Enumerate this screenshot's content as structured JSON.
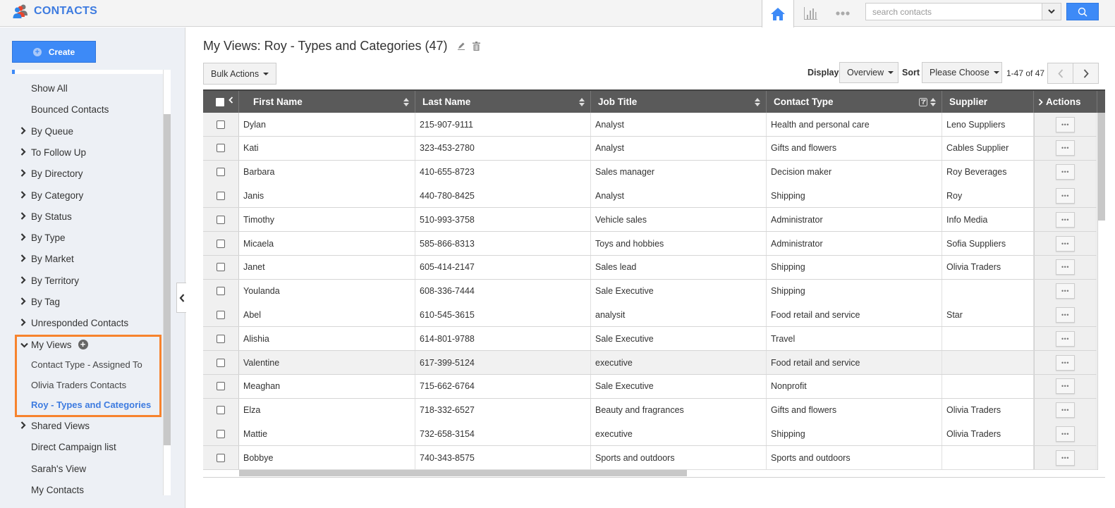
{
  "app": {
    "title": "CONTACTS",
    "icon": "contacts-people-icon",
    "brand_color": "#3d7be0"
  },
  "topbar": {
    "tabs": [
      {
        "name": "home",
        "icon": "home-icon",
        "active": true
      },
      {
        "name": "reports",
        "icon": "bar-chart-icon",
        "active": false
      },
      {
        "name": "more",
        "icon": "more-dots-icon",
        "active": false
      }
    ],
    "search": {
      "placeholder": "search contacts",
      "value": ""
    }
  },
  "sidebar": {
    "create_label": "Create",
    "items": [
      {
        "label": "Show All",
        "type": "plain"
      },
      {
        "label": "Bounced Contacts",
        "type": "plain"
      },
      {
        "label": "By Queue",
        "type": "group"
      },
      {
        "label": "To Follow Up",
        "type": "group"
      },
      {
        "label": "By Directory",
        "type": "group"
      },
      {
        "label": "By Category",
        "type": "group"
      },
      {
        "label": "By Status",
        "type": "group"
      },
      {
        "label": "By Type",
        "type": "group"
      },
      {
        "label": "By Market",
        "type": "group"
      },
      {
        "label": "By Territory",
        "type": "group"
      },
      {
        "label": "By Tag",
        "type": "group"
      },
      {
        "label": "Unresponded Contacts",
        "type": "group"
      },
      {
        "label": "My Views",
        "type": "expanded"
      },
      {
        "label": "Contact Type - Assigned To",
        "type": "child"
      },
      {
        "label": "Olivia Traders Contacts",
        "type": "child"
      },
      {
        "label": "Roy - Types and Categories",
        "type": "child",
        "active": true
      },
      {
        "label": "Shared Views",
        "type": "group"
      },
      {
        "label": "Direct Campaign list",
        "type": "plain"
      },
      {
        "label": "Sarah's View",
        "type": "plain"
      },
      {
        "label": "My Contacts",
        "type": "plain"
      }
    ]
  },
  "main": {
    "title": "My Views: Roy - Types and Categories (47)",
    "bulk_actions_label": "Bulk Actions",
    "display_label": "Display",
    "display_value": "Overview",
    "sort_label": "Sort",
    "sort_value": "Please Choose",
    "pager_text": "1-47 of 47",
    "columns": [
      "First Name",
      "Last Name",
      "Job Title",
      "Contact Type",
      "Supplier",
      "Actions"
    ],
    "actions_button_label": "•••",
    "rows": [
      {
        "first": "Dylan",
        "last": "215-907-9111",
        "job": "Analyst",
        "type": "Health and personal care",
        "supplier": "Leno Suppliers"
      },
      {
        "first": "Kati",
        "last": "323-453-2780",
        "job": "Analyst",
        "type": "Gifts and flowers",
        "supplier": "Cables Supplier"
      },
      {
        "first": "Barbara",
        "last": "410-655-8723",
        "job": "Sales manager",
        "type": "Decision maker",
        "supplier": "Roy Beverages"
      },
      {
        "first": "Janis",
        "last": "440-780-8425",
        "job": "Analyst",
        "type": "Shipping",
        "supplier": "Roy"
      },
      {
        "first": "Timothy",
        "last": "510-993-3758",
        "job": "Vehicle sales",
        "type": "Administrator",
        "supplier": "Info Media"
      },
      {
        "first": "Micaela",
        "last": "585-866-8313",
        "job": "Toys and hobbies",
        "type": "Administrator",
        "supplier": "Sofia Suppliers"
      },
      {
        "first": "Janet",
        "last": "605-414-2147",
        "job": "Sales lead",
        "type": "Shipping",
        "supplier": "Olivia Traders"
      },
      {
        "first": "Youlanda",
        "last": "608-336-7444",
        "job": "Sale Executive",
        "type": "Shipping",
        "supplier": ""
      },
      {
        "first": "Abel",
        "last": "610-545-3615",
        "job": "analysit",
        "type": "Food retail and service",
        "supplier": "Star"
      },
      {
        "first": "Alishia",
        "last": "614-801-9788",
        "job": "Sale Executive",
        "type": "Travel",
        "supplier": ""
      },
      {
        "first": "Valentine",
        "last": "617-399-5124",
        "job": "executive",
        "type": "Food retail and service",
        "supplier": "",
        "hover": true
      },
      {
        "first": "Meaghan",
        "last": "715-662-6764",
        "job": "Sale Executive",
        "type": "Nonprofit",
        "supplier": ""
      },
      {
        "first": "Elza",
        "last": "718-332-6527",
        "job": "Beauty and fragrances",
        "type": "Gifts and flowers",
        "supplier": "Olivia Traders"
      },
      {
        "first": "Mattie",
        "last": "732-658-3154",
        "job": "executive",
        "type": "Shipping",
        "supplier": "Olivia Traders"
      },
      {
        "first": "Bobbye",
        "last": "740-343-8575",
        "job": "Sports and outdoors",
        "type": "Sports and outdoors",
        "supplier": ""
      }
    ]
  }
}
